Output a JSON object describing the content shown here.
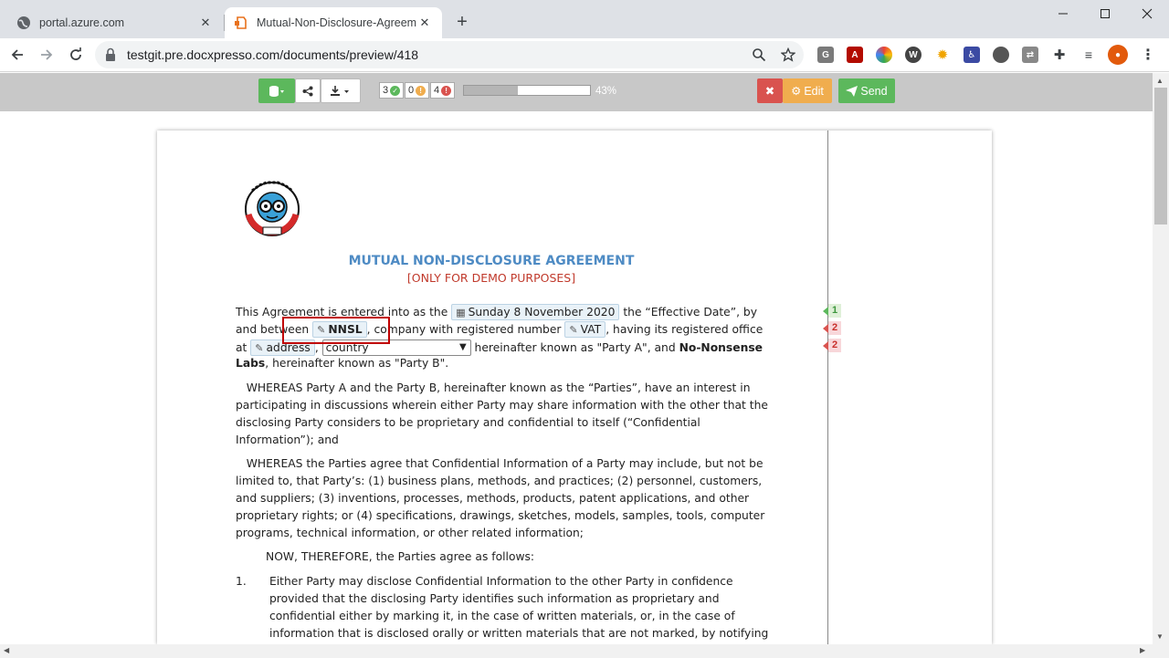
{
  "browser": {
    "tabs": [
      {
        "title": "portal.azure.com",
        "active": false
      },
      {
        "title": "Mutual-Non-Disclosure-Agreement",
        "active": true
      }
    ],
    "url": "testgit.pre.docxpresso.com/documents/preview/418"
  },
  "app_toolbar": {
    "counters": {
      "complete": "3",
      "warning": "0",
      "error": "4"
    },
    "progress": {
      "value": 0.43,
      "label": "43%"
    },
    "edit_label": "Edit",
    "send_label": "Send",
    "colors": {
      "green": "#5cb85c",
      "red": "#d9534f",
      "orange": "#f0ad4e"
    }
  },
  "document": {
    "title": "MUTUAL NON-DISCLOSURE AGREEMENT",
    "subtitle": "[ONLY FOR DEMO PURPOSES]",
    "logo_text": "NO-NONSENSE LABS",
    "p1": {
      "t1": "This Agreement is entered into as the ",
      "date_field": "Sunday 8 November 2020",
      "t2": " the “Effective Date”, by",
      "t3": "and between ",
      "company_field": "NNSL",
      "t4": ", company with registered number ",
      "vat_field": "VAT",
      "t5": ", having its registered office",
      "t6": "at ",
      "address_field": "address",
      "t7": ", ",
      "country_select": "country",
      "t8": " hereinafter known as \"Party A\", and ",
      "party_b_bold": "No-Nonsense",
      "party_b_bold2": "Labs",
      "t9": ", hereinafter known as \"Party B\"."
    },
    "p2": [
      "   WHEREAS Party A and the Party B, hereinafter known as the “Parties”, have an interest in",
      "participating in discussions wherein either Party may share information with the other that the",
      "disclosing Party considers to be proprietary and confidential to itself (“Confidential",
      "Information”); and"
    ],
    "p3": [
      "   WHEREAS the Parties agree that Confidential Information of a Party may include, but not be",
      "limited to, that Party’s: (1) business plans, methods, and practices; (2) personnel, customers,",
      "and suppliers; (3) inventions, processes, methods, products, patent applications, and other",
      "proprietary rights; or (4) specifications, drawings, sketches, models, samples, tools, computer",
      "programs, technical information, or other related information;"
    ],
    "p4": "NOW, THEREFORE, the Parties agree as follows:",
    "list_num": "1.",
    "list1": [
      "Either Party may disclose Confidential Information to the other Party in confidence",
      "provided that the disclosing Party identifies such information as proprietary and",
      "confidential either by marking it, in the case of written materials, or, in the case of",
      "information that is disclosed orally or written materials that are not marked, by notifying"
    ]
  },
  "margin_flags": [
    {
      "value": "1",
      "color": "#5cb85c"
    },
    {
      "value": "2",
      "color": "#d9534f"
    },
    {
      "value": "2",
      "color": "#d9534f"
    }
  ]
}
